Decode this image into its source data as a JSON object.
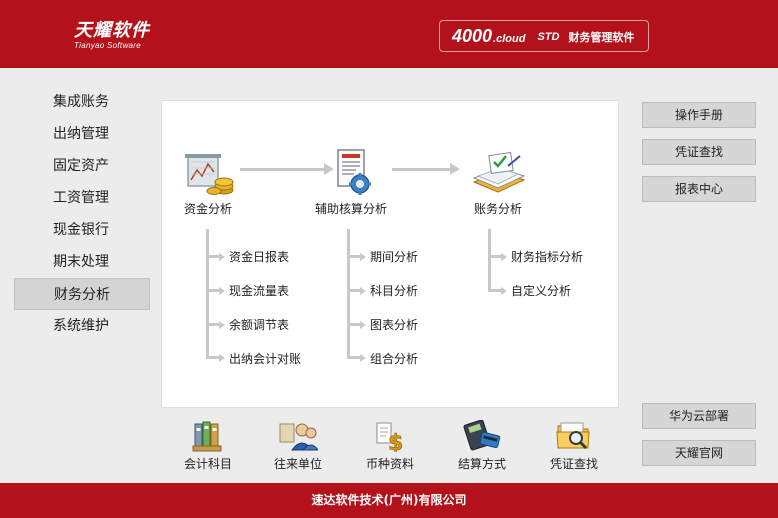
{
  "header": {
    "logo_text": "天耀软件",
    "logo_subtext": "Tianyao Software",
    "product_version": "4000",
    "product_cloud": ".cloud",
    "product_edition": "STD",
    "product_name": "财务管理软件"
  },
  "sidebar": {
    "items": [
      {
        "label": "集成账务",
        "active": false
      },
      {
        "label": "出纳管理",
        "active": false
      },
      {
        "label": "固定资产",
        "active": false
      },
      {
        "label": "工资管理",
        "active": false
      },
      {
        "label": "现金银行",
        "active": false
      },
      {
        "label": "期末处理",
        "active": false
      },
      {
        "label": "财务分析",
        "active": true
      },
      {
        "label": "系统维护",
        "active": false
      }
    ]
  },
  "flow": {
    "nodes": [
      {
        "label": "资金分析",
        "icon": "fund-chart-coins-icon"
      },
      {
        "label": "辅助核算分析",
        "icon": "report-gear-icon"
      },
      {
        "label": "账务分析",
        "icon": "ledger-check-icon"
      }
    ],
    "branches": [
      [
        "资金日报表",
        "现金流量表",
        "余额调节表",
        "出纳会计对账"
      ],
      [
        "期间分析",
        "科目分析",
        "图表分析",
        "组合分析"
      ],
      [
        "财务指标分析",
        "自定义分析"
      ]
    ]
  },
  "right_buttons": {
    "top": [
      "操作手册",
      "凭证查找",
      "报表中心"
    ],
    "bottom": [
      "华为云部署",
      "天耀官网"
    ]
  },
  "toolbar": [
    {
      "label": "会计科目",
      "icon": "binders-icon"
    },
    {
      "label": "往来单位",
      "icon": "people-icon"
    },
    {
      "label": "币种资料",
      "icon": "currency-dollar-icon"
    },
    {
      "label": "结算方式",
      "icon": "calculator-card-icon"
    },
    {
      "label": "凭证查找",
      "icon": "folder-search-icon"
    }
  ],
  "footer": {
    "company": "速达软件技术(广州)有限公司"
  },
  "colors": {
    "brand_red": "#b3121b",
    "background": "#ececec",
    "connector_gray": "#c8c8c8"
  }
}
